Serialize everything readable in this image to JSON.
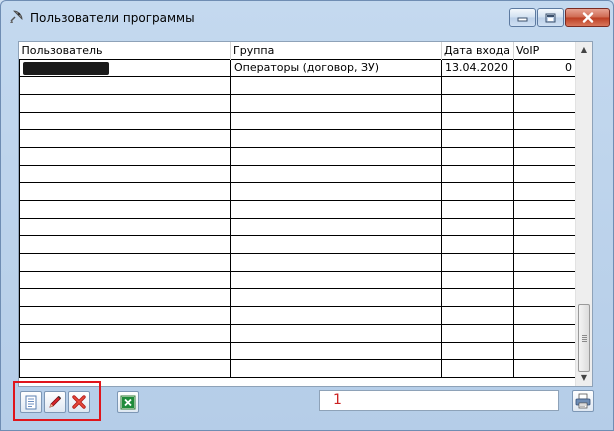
{
  "window": {
    "title": "Пользователи программы",
    "icons": {
      "app": "satellite-dish-icon",
      "minimize": "minimize-icon",
      "maximize": "maximize-icon",
      "close": "close-icon"
    }
  },
  "table": {
    "columns": [
      "Пользователь",
      "Группа",
      "Дата входа",
      "VoIP"
    ],
    "rows": [
      {
        "user": "[redacted]",
        "group": "Операторы (договор, ЗУ)",
        "date": "13.04.2020",
        "voip": "0"
      }
    ]
  },
  "toolbar": {
    "icons": {
      "add": "new-document-icon",
      "edit": "pencil-icon",
      "delete": "delete-x-icon",
      "excel": "excel-export-icon",
      "print": "printer-icon"
    },
    "highlight_color": "#e0151b"
  },
  "status": {
    "count": "1"
  }
}
